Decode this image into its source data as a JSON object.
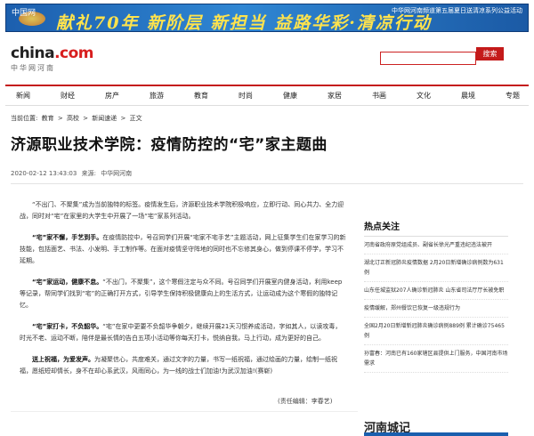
{
  "banner": {
    "left_text": "中国网",
    "slogan": "献礼70年  新阶层  新担当  益路华彩·清凉行动",
    "top_right": "中华网河南频道第五届夏日送清凉系列公益活动"
  },
  "header": {
    "logo_main": "china",
    "logo_dot": ".com",
    "logo_sub": "中华网河南",
    "search_placeholder": "",
    "search_button": "搜索"
  },
  "nav": [
    "新闻",
    "财经",
    "房产",
    "旅游",
    "教育",
    "时尚",
    "健康",
    "家居",
    "书画",
    "文化",
    "晨境",
    "专题"
  ],
  "breadcrumb": [
    "当前位置:",
    "教育",
    ">",
    "高校",
    ">",
    "新闻速递",
    ">",
    "正文"
  ],
  "article": {
    "title": "济源职业技术学院：疫情防控的“宅”家主题曲",
    "date": "2020-02-12 13:43:03",
    "source_label": "来源:",
    "source": "中华网河南",
    "paragraphs": [
      {
        "lead": "",
        "text": "“不出门、不聚集”成为当前独特的标签。疫情发生后，济源职业技术学院积极响应，立即行动、同心共力、全力迎战，同时对“宅”在家里的大学生中开展了一场“宅”家系列活动。"
      },
      {
        "lead": "“宅”家不懈，手艺到手。",
        "text": "在疫情防控中，号召同学们开展“宅家不宅手艺”主题活动，网上征集学生们在家学习的新技能，包括面艺、书法、小发明、手工制作等。在面对疫情坚守阵地的同时也不忘修其身心，做到停课不停学，学习不延期。"
      },
      {
        "lead": "“宅”家运动，健康不怠。",
        "text": "“不出门，不聚集”，这个寒假注定与众不同。号召同学们开展室内健身活动，利用keep等记录，帮同学们找到“宅”的正确打开方式，引导学生保持积极健康向上的生活方式，让运动成为这个寒假的独特记忆。"
      },
      {
        "lead": "“宅”家打卡，不负韶华。",
        "text": "“宅”在家中更要不负韶华争朝夕，继续开展21天习惯养成活动，字如其人，以读攻毒，时光不老、运动不断，陪伴是最长情的告白五项小活动等你每天打卡，悦纳自我，马上行动，成为更好的自己。"
      },
      {
        "lead": "送上祝福，为爱发声。",
        "text": "为凝聚信心，共度难关，通过文字的力量，书写一纸祝福，通过绘画的力量，绘制一纸祝福，愿纸短却情长，身不在却心系武汉，风雨同心，为一线的战士们加油!为武汉加油!(赛崭)"
      }
    ],
    "editor": "(责任编辑：李春艺)"
  },
  "sidebar": {
    "title": "热点关注",
    "items": [
      "河南省政府原党组成员、副省长徐光严重违纪违法被开",
      "湖北订正新冠肺炎疫情数据 2月20日新增确诊病例数为631例",
      "山东任城监狱207人确诊新冠肺炎 山东省司法厅厅长被免职",
      "疫情缓解，郑州餐饮已恢复一级违规行为",
      "全国2月20日新增新冠肺炎确诊病例889例 累计确诊75465例",
      "孙富春：河南已有160家辖区县提供上门服务，中国河南市场需求"
    ],
    "block2_title": "河南城记"
  }
}
